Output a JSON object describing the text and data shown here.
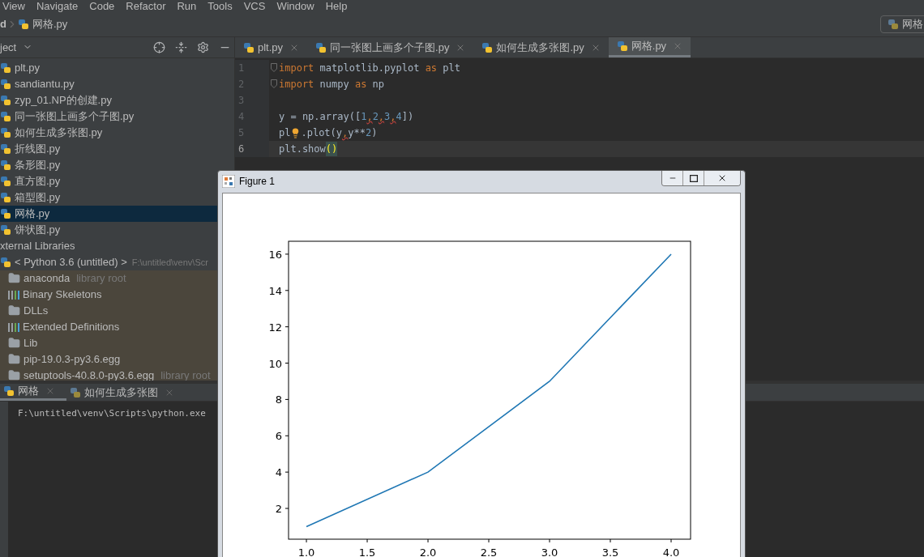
{
  "menu": [
    "View",
    "Navigate",
    "Code",
    "Refactor",
    "Run",
    "Tools",
    "VCS",
    "Window",
    "Help"
  ],
  "breadcrumb": {
    "root": "d",
    "file": "网格.py"
  },
  "run_config": {
    "label": "网格"
  },
  "project_panel": {
    "title": "ject",
    "tree": [
      {
        "label": "plt.py",
        "kind": "file",
        "selected": false
      },
      {
        "label": "sandiantu.py",
        "kind": "file",
        "selected": false
      },
      {
        "label": "zyp_01.NP的创建.py",
        "kind": "file",
        "selected": false
      },
      {
        "label": "同一张图上画多个子图.py",
        "kind": "file",
        "selected": false
      },
      {
        "label": "如何生成多张图.py",
        "kind": "file",
        "selected": false
      },
      {
        "label": "折线图.py",
        "kind": "file",
        "selected": false
      },
      {
        "label": "条形图.py",
        "kind": "file",
        "selected": false
      },
      {
        "label": "直方图.py",
        "kind": "file",
        "selected": false
      },
      {
        "label": "箱型图.py",
        "kind": "file",
        "selected": false
      },
      {
        "label": "网格.py",
        "kind": "file",
        "selected": true
      },
      {
        "label": "饼状图.py",
        "kind": "file",
        "selected": false
      },
      {
        "label": "xternal Libraries",
        "kind": "group",
        "selected": false,
        "children": [
          {
            "label": "< Python 3.6 (untitled) >",
            "kind": "sdk",
            "path": "F:\\untitled\\venv\\Scr",
            "selected": false,
            "children": [
              {
                "label": "anaconda",
                "kind": "folder",
                "hint": "library root",
                "selected": false
              },
              {
                "label": "Binary Skeletons",
                "kind": "library",
                "selected": false
              },
              {
                "label": "DLLs",
                "kind": "folder",
                "selected": false
              },
              {
                "label": "Extended Definitions",
                "kind": "library",
                "selected": false
              },
              {
                "label": "Lib",
                "kind": "folder",
                "selected": false
              },
              {
                "label": "pip-19.0.3-py3.6.egg",
                "kind": "folder",
                "selected": false
              },
              {
                "label": "setuptools-40.8.0-py3.6.egg",
                "kind": "folder",
                "hint": "library root",
                "selected": false
              }
            ]
          }
        ]
      }
    ]
  },
  "editor": {
    "tabs": [
      {
        "label": "plt.py",
        "selected": false
      },
      {
        "label": "同一张图上画多个子图.py",
        "selected": false
      },
      {
        "label": "如何生成多张图.py",
        "selected": false
      },
      {
        "label": "网格.py",
        "selected": true
      }
    ],
    "lines": [
      {
        "number": "1",
        "current": false,
        "fold": true,
        "tokens": [
          {
            "kind": "keyword",
            "text": "import"
          },
          {
            "kind": "plain",
            "text": " matplotlib.pyplot "
          },
          {
            "kind": "keyword",
            "text": "as"
          },
          {
            "kind": "plain",
            "text": " plt"
          }
        ]
      },
      {
        "number": "2",
        "current": false,
        "fold": true,
        "tokens": [
          {
            "kind": "keyword",
            "text": "import"
          },
          {
            "kind": "plain",
            "text": " numpy "
          },
          {
            "kind": "keyword",
            "text": "as"
          },
          {
            "kind": "plain",
            "text": " np"
          }
        ]
      },
      {
        "number": "3",
        "current": false,
        "fold": false
      },
      {
        "number": "4",
        "current": false,
        "fold": false,
        "tokens": [
          {
            "kind": "plain",
            "text": "y = np.array(["
          },
          {
            "kind": "number",
            "text": "1"
          },
          {
            "kind": "warn",
            "text": ","
          },
          {
            "kind": "number",
            "text": "2"
          },
          {
            "kind": "warn",
            "text": ","
          },
          {
            "kind": "number",
            "text": "3"
          },
          {
            "kind": "warn",
            "text": ","
          },
          {
            "kind": "number",
            "text": "4"
          },
          {
            "kind": "plain",
            "text": "])"
          }
        ]
      },
      {
        "number": "5",
        "current": false,
        "fold": false,
        "tokens": [
          {
            "kind": "plain",
            "text": "pl"
          },
          {
            "kind": "bulb"
          },
          {
            "kind": "plain",
            "text": ".plot(y"
          },
          {
            "kind": "warn",
            "text": ","
          },
          {
            "kind": "plain",
            "text": "y**"
          },
          {
            "kind": "number",
            "text": "2"
          },
          {
            "kind": "plain",
            "text": ")"
          }
        ]
      },
      {
        "number": "6",
        "current": true,
        "fold": false,
        "tokens": [
          {
            "kind": "plain",
            "text": "plt.show"
          },
          {
            "kind": "brace",
            "text": "()"
          }
        ]
      }
    ]
  },
  "run_panel": {
    "tabs": [
      {
        "label": "网格",
        "selected": true
      },
      {
        "label": "如何生成多张图",
        "selected": false
      }
    ],
    "output": "F:\\untitled\\venv\\Scripts\\python.exe"
  },
  "figure": {
    "title": "Figure 1",
    "chart_data": {
      "type": "line",
      "x": [
        1,
        2,
        3,
        4
      ],
      "series": [
        {
          "color": "#1f77b4",
          "values": [
            1,
            4,
            9,
            16
          ]
        }
      ],
      "xlim": [
        0.853,
        4.16
      ],
      "ylim": [
        0.306,
        16.71
      ],
      "xticks": [
        {
          "value": 1,
          "label": "1.0"
        },
        {
          "value": 1.5,
          "label": "1.5"
        },
        {
          "value": 2,
          "label": "2.0"
        },
        {
          "value": 2.5,
          "label": "2.5"
        },
        {
          "value": 3,
          "label": "3.0"
        },
        {
          "value": 3.5,
          "label": "3.5"
        },
        {
          "value": 4,
          "label": "4.0"
        }
      ],
      "yticks": [
        2,
        4,
        6,
        8,
        10,
        12,
        14,
        16
      ]
    }
  }
}
